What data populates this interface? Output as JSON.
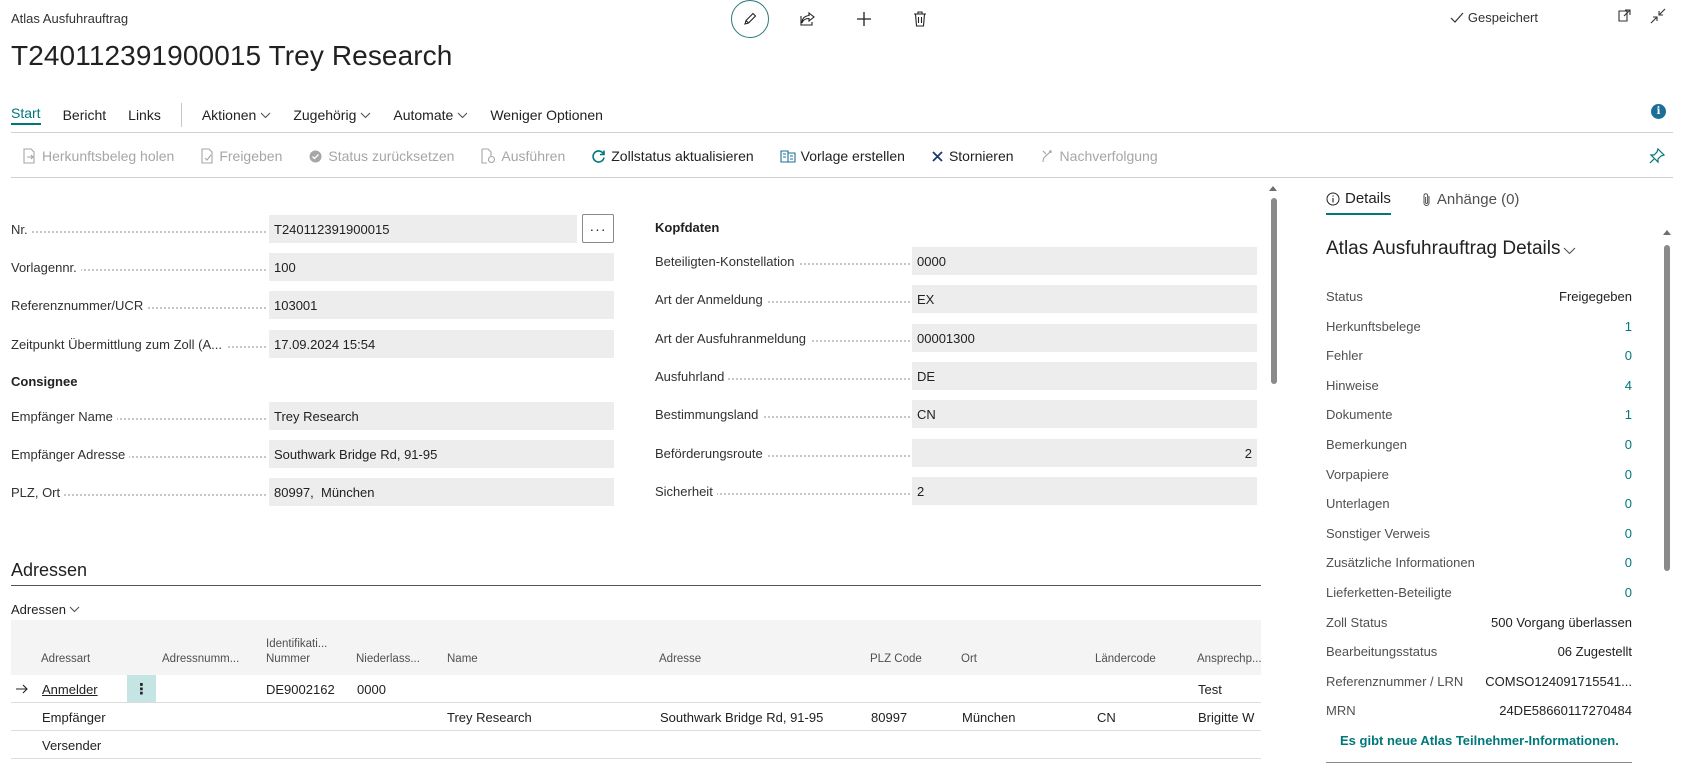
{
  "header": {
    "caption": "Atlas Ausfuhrauftrag",
    "title": "T240112391900015 Trey Research",
    "saved": "Gespeichert"
  },
  "menu": {
    "items": [
      {
        "label": "Start"
      },
      {
        "label": "Bericht"
      },
      {
        "label": "Links"
      }
    ],
    "dropdowns": [
      {
        "label": "Aktionen"
      },
      {
        "label": "Zugehörig"
      },
      {
        "label": "Automate"
      }
    ],
    "less": "Weniger Optionen"
  },
  "toolbar": {
    "items": [
      {
        "label": "Herkunftsbeleg holen",
        "enabled": false
      },
      {
        "label": "Freigeben",
        "enabled": false
      },
      {
        "label": "Status zurücksetzen",
        "enabled": false
      },
      {
        "label": "Ausführen",
        "enabled": false
      },
      {
        "label": "Zollstatus aktualisieren",
        "enabled": true
      },
      {
        "label": "Vorlage erstellen",
        "enabled": true
      },
      {
        "label": "Stornieren",
        "enabled": true
      },
      {
        "label": "Nachverfolgung",
        "enabled": false
      }
    ]
  },
  "form_left": {
    "nr": {
      "label": "Nr.",
      "value": "T240112391900015"
    },
    "vorlagennr": {
      "label": "Vorlagennr.",
      "value": "100"
    },
    "referenz": {
      "label": "Referenznummer/UCR",
      "value": "103001"
    },
    "zeitpunkt": {
      "label": "Zeitpunkt Übermittlung zum Zoll (A...",
      "value": "17.09.2024 15:54"
    },
    "consignee_head": "Consignee",
    "empf_name": {
      "label": "Empfänger Name",
      "value": "Trey Research"
    },
    "empf_adresse": {
      "label": "Empfänger Adresse",
      "value": "Southwark Bridge Rd, 91-95"
    },
    "plz_ort": {
      "label": "PLZ, Ort",
      "value": "80997,  München"
    }
  },
  "form_right": {
    "head": "Kopfdaten",
    "beteiligten": {
      "label": "Beteiligten-Konstellation",
      "value": "0000"
    },
    "art_anmeldung": {
      "label": "Art der Anmeldung",
      "value": "EX"
    },
    "art_ausfuhr": {
      "label": "Art der Ausfuhranmeldung",
      "value": "00001300"
    },
    "ausfuhrland": {
      "label": "Ausfuhrland",
      "value": "DE"
    },
    "bestimmungsland": {
      "label": "Bestimmungsland",
      "value": "CN"
    },
    "befoerderung": {
      "label": "Beförderungsroute",
      "value": "2"
    },
    "sicherheit": {
      "label": "Sicherheit",
      "value": "2"
    }
  },
  "adressen": {
    "title": "Adressen",
    "subtitle": "Adressen",
    "columns": {
      "adressart": "Adressart",
      "adressnummer": "Adressnumm...",
      "ident_1": "Identifikati...",
      "ident_2": "Nummer",
      "niederlassung": "Niederlass...",
      "name": "Name",
      "adresse": "Adresse",
      "plz": "PLZ Code",
      "ort": "Ort",
      "laendercode": "Ländercode",
      "ansprech": "Ansprechp..."
    },
    "rows": [
      {
        "adressart": "Anmelder",
        "adressnummer": "",
        "ident": "DE9002162",
        "niederlassung": "0000",
        "name": "",
        "adresse": "",
        "plz": "",
        "ort": "",
        "laendercode": "",
        "ansprech": "Test"
      },
      {
        "adressart": "Empfänger",
        "adressnummer": "",
        "ident": "",
        "niederlassung": "",
        "name": "Trey Research",
        "adresse": "Southwark Bridge Rd, 91-95",
        "plz": "80997",
        "ort": "München",
        "laendercode": "CN",
        "ansprech": "Brigitte W"
      },
      {
        "adressart": "Versender",
        "adressnummer": "",
        "ident": "",
        "niederlassung": "",
        "name": "",
        "adresse": "",
        "plz": "",
        "ort": "",
        "laendercode": "",
        "ansprech": ""
      }
    ]
  },
  "factbox": {
    "tab_details": "Details",
    "tab_anhaenge": "Anhänge (0)",
    "title": "Atlas Ausfuhrauftrag Details",
    "rows": [
      {
        "key": "Status",
        "value": "Freigegeben"
      },
      {
        "key": "Herkunftsbelege",
        "value": "1"
      },
      {
        "key": "Fehler",
        "value": "0"
      },
      {
        "key": "Hinweise",
        "value": "4"
      },
      {
        "key": "Dokumente",
        "value": "1"
      },
      {
        "key": "Bemerkungen",
        "value": "0"
      },
      {
        "key": "Vorpapiere",
        "value": "0"
      },
      {
        "key": "Unterlagen",
        "value": "0"
      },
      {
        "key": "Sonstiger Verweis",
        "value": "0"
      },
      {
        "key": "Zusätzliche Informationen",
        "value": "0"
      },
      {
        "key": "Lieferketten-Beteiligte",
        "value": "0"
      },
      {
        "key": "Zoll Status",
        "value": "500 Vorgang überlassen"
      },
      {
        "key": "Bearbeitungsstatus",
        "value": "06 Zugestellt"
      },
      {
        "key": "Referenznummer / LRN",
        "value": "COMSO124091715541..."
      },
      {
        "key": "MRN",
        "value": "24DE58660117270484"
      }
    ],
    "note": "Es gibt neue Atlas Teilnehmer-Informationen."
  },
  "colors": {
    "accent": "#00787a",
    "field_bg": "#ededed",
    "info": "#1b6f96"
  }
}
